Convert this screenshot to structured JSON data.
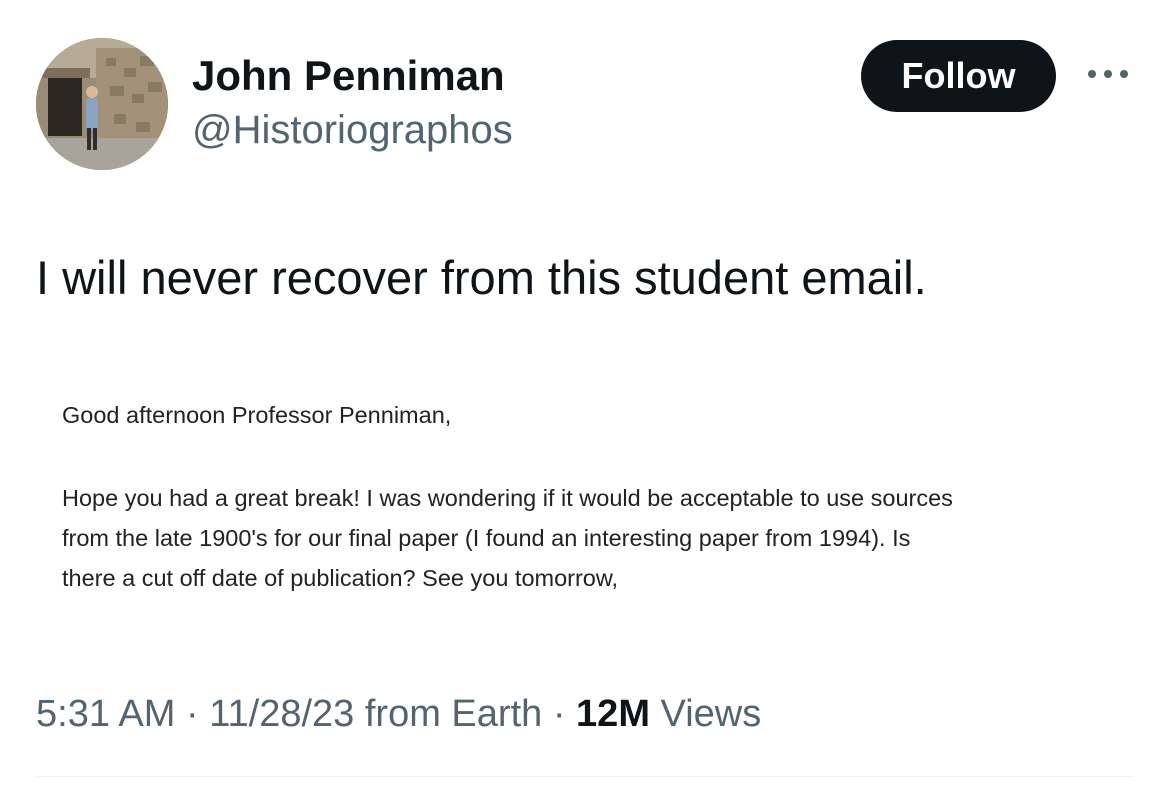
{
  "author": {
    "display_name": "John Penniman",
    "handle": "@Historiographos",
    "avatar_icon": "profile-photo-icon"
  },
  "actions": {
    "follow_label": "Follow",
    "more_icon": "more-options-icon"
  },
  "tweet": {
    "text": "I will never recover from this student email.",
    "attached_email": {
      "greeting": "Good afternoon Professor Penniman,",
      "body_lines": [
        "Hope you had a great break! I was wondering if it would be acceptable to use sources",
        "from the late 1900's for our final paper (I found an interesting paper from 1994). Is",
        "there a cut off date of publication? See you tomorrow,"
      ]
    }
  },
  "meta": {
    "time": "5:31 AM",
    "separator": "·",
    "date": "11/28/23",
    "source": "from Earth",
    "views_count": "12M",
    "views_label": "Views"
  },
  "colors": {
    "text_primary": "#0f1419",
    "text_secondary": "#536471",
    "button_bg": "#0f1419",
    "divider": "#eff3f4"
  }
}
